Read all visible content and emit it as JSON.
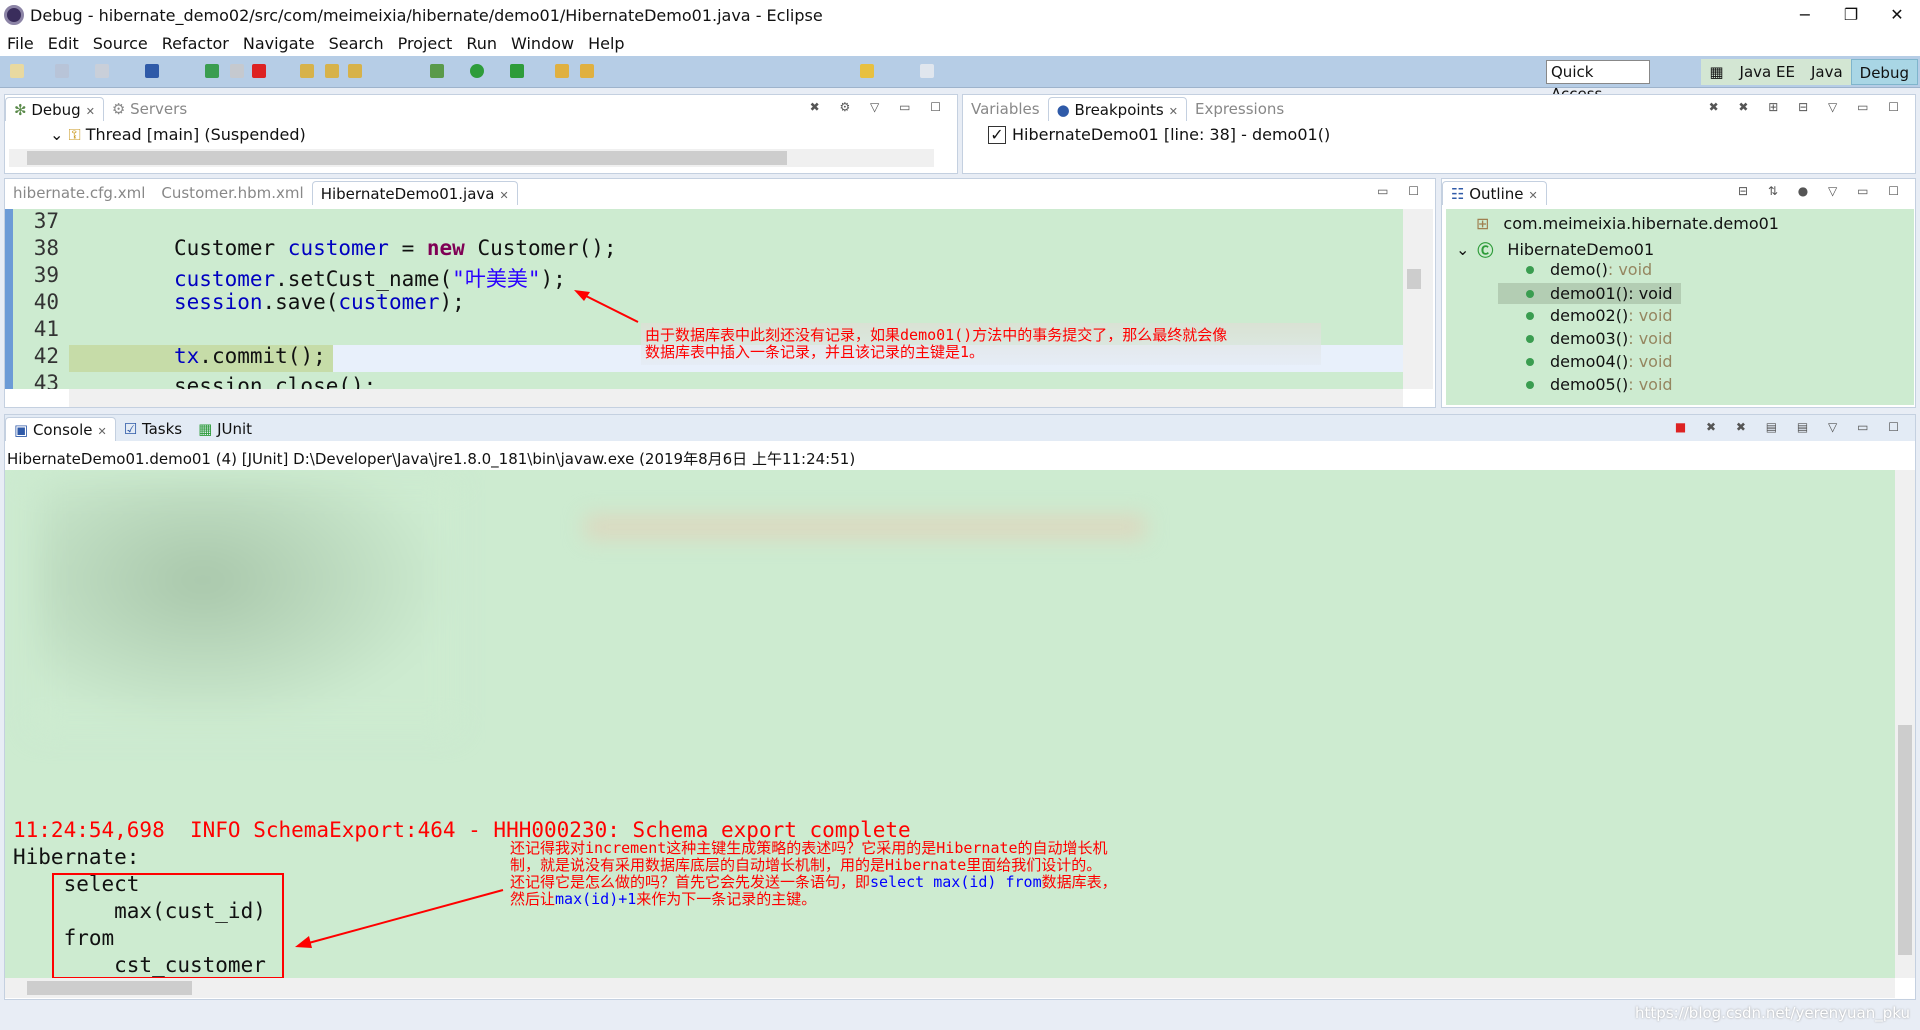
{
  "window": {
    "title": "Debug - hibernate_demo02/src/com/meimeixia/hibernate/demo01/HibernateDemo01.java - Eclipse",
    "minimize": "−",
    "restore": "❐",
    "close": "✕"
  },
  "menu": [
    "File",
    "Edit",
    "Source",
    "Refactor",
    "Navigate",
    "Search",
    "Project",
    "Run",
    "Window",
    "Help"
  ],
  "toolbar": {
    "quick_access": "Quick Access",
    "perspectives": [
      "Java EE",
      "Java",
      "Debug"
    ],
    "active_perspective": "Debug"
  },
  "debug_panel": {
    "tabs": [
      "Debug",
      "Servers"
    ],
    "thread": "Thread [main] (Suspended)"
  },
  "breakpoints_panel": {
    "tabs": [
      "Variables",
      "Breakpoints",
      "Expressions"
    ],
    "active": "Breakpoints",
    "items": [
      {
        "label": "HibernateDemo01 [line: 38] - demo01()",
        "checked": true
      }
    ]
  },
  "editor": {
    "tabs": [
      "hibernate.cfg.xml",
      "Customer.hbm.xml",
      "HibernateDemo01.java"
    ],
    "active": "HibernateDemo01.java",
    "line_numbers": [
      "37",
      "38",
      "39",
      "40",
      "41",
      "42",
      "43"
    ],
    "code": {
      "l38a": "Customer ",
      "l38b": "customer",
      "l38c": " = ",
      "l38d": "new",
      "l38e": " Customer();",
      "l39a": "customer",
      "l39b": ".setCust_name(",
      "l39c": "\"叶美美\"",
      "l39d": ");",
      "l40a": "session",
      "l40b": ".save(",
      "l40c": "customer",
      "l40d": ");",
      "l42a": "tx",
      "l42b": ".commit();",
      "l43": "session.close();"
    },
    "annotation": [
      "由于数据库表中此刻还没有记录，如果demo01()方法中的事务提交了，那么最终就会像",
      "数据库表中插入一条记录，并且该记录的主键是1。"
    ]
  },
  "outline": {
    "tab": "Outline",
    "package": "com.meimeixia.hibernate.demo01",
    "class": "HibernateDemo01",
    "methods": [
      {
        "name": "demo()",
        "type": " : void"
      },
      {
        "name": "demo01()",
        "type": " : void",
        "selected": true
      },
      {
        "name": "demo02()",
        "type": " : void"
      },
      {
        "name": "demo03()",
        "type": " : void"
      },
      {
        "name": "demo04()",
        "type": " : void"
      },
      {
        "name": "demo05()",
        "type": " : void"
      }
    ]
  },
  "console": {
    "tabs": [
      "Console",
      "Tasks",
      "JUnit"
    ],
    "header": "HibernateDemo01.demo01 (4) [JUnit] D:\\Developer\\Java\\jre1.8.0_181\\bin\\javaw.exe (2019年8月6日 上午11:24:51)",
    "lines": [
      "11:24:54,698  INFO SchemaExport:464 - HHH000230: Schema export complete",
      "Hibernate: ",
      "    select",
      "        max(cust_id)",
      "    from",
      "        cst_customer"
    ],
    "annotation": {
      "l1": "还记得我对increment这种主键生成策略的表述吗？它采用的是Hibernate的自动增长机",
      "l2": "制，就是说没有采用数据库底层的自动增长机制，用的是Hibernate里面给我们设计的。",
      "l3a": "还记得它是怎么做的吗？首先它会先发送一条语句，即",
      "l3b": "select max(id) from",
      "l3c": "数据库表，",
      "l4a": "然后让",
      "l4b": "max(id)+1",
      "l4c": "来作为下一条记录的主键。"
    }
  },
  "watermark": "https://blog.csdn.net/yerenyuan_pku",
  "colors": {
    "annotation": "#ff0000",
    "console_bg": "#cdebd0",
    "highlight_box": "#ff0000"
  }
}
